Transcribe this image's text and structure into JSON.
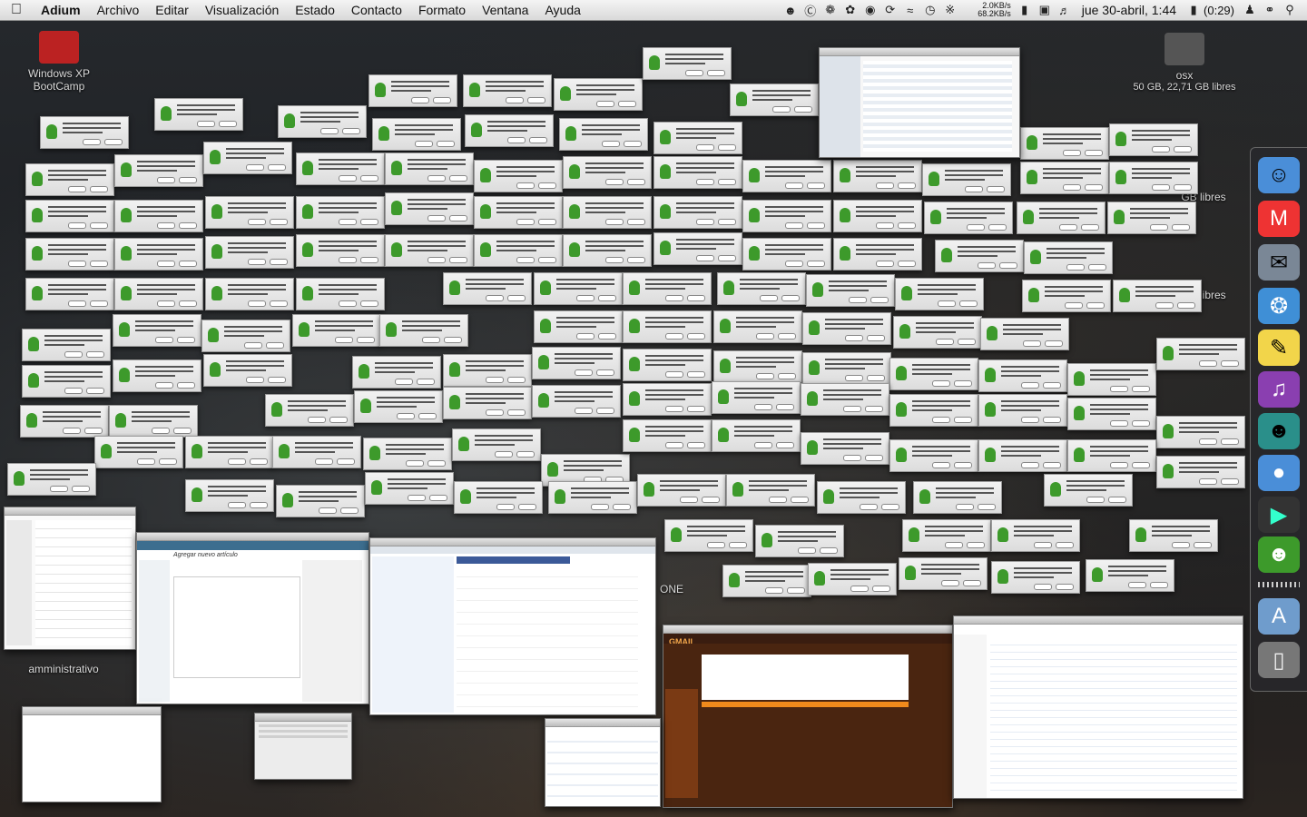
{
  "menubar": {
    "apple_icon": "apple-icon",
    "app_name": "Adium",
    "menus": [
      "Archivo",
      "Editar",
      "Visualización",
      "Estado",
      "Contacto",
      "Formato",
      "Ventana",
      "Ayuda"
    ],
    "net_up": "2.0KB/s",
    "net_down": "68.2KB/s",
    "clock": "jue 30-abril, 1:44",
    "battery": "(0:29)"
  },
  "desktop_icons": {
    "winxp": "Windows XP\nBootCamp",
    "osx_name": "osx",
    "osx_free": "50 GB, 22,71 GB libres",
    "amministrativo": "amministrativo",
    "gb_libres_1": "GB libres",
    "gb_libres_2": "GB libres",
    "one": "ONE"
  },
  "windows": {
    "blog_title": "Agregar nuevo artículo",
    "gmail_logo": "GMAIL"
  },
  "dock": {
    "items": [
      "finder-icon",
      "gmail-icon",
      "mail-icon",
      "safari-icon",
      "stickies-icon",
      "itunes-icon",
      "avatar-icon",
      "bluetooth-icon",
      "stamp-icon",
      "adium-icon",
      "applications-folder-icon",
      "trash-icon"
    ]
  },
  "colors": {
    "adium_green": "#3d9a2b",
    "gmail_orange": "#f08a1c"
  }
}
